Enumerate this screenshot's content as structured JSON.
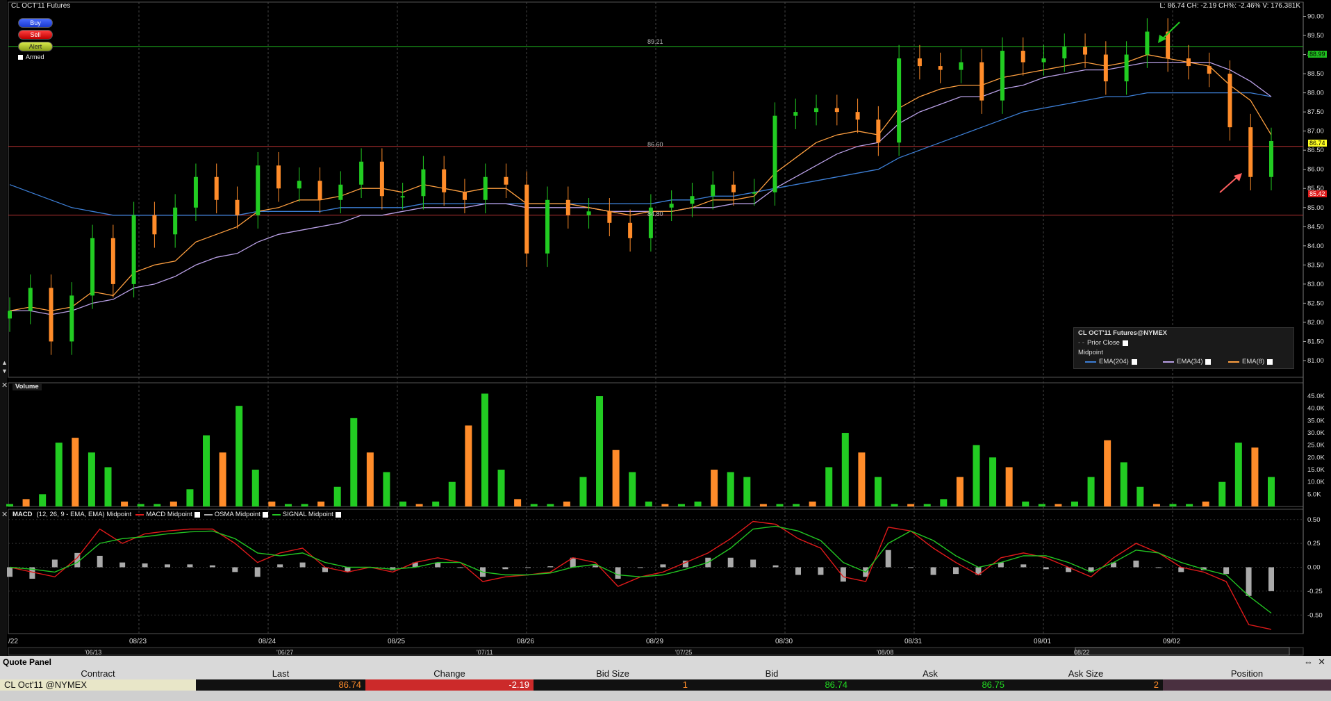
{
  "chart": {
    "title": "CL OCT'11 Futures",
    "status_line": "L: 86.74 CH: -2.19 CH%: -2.46% V: 176.381K",
    "buttons": {
      "buy": "Buy",
      "sell": "Sell",
      "alert": "Alert",
      "armed": "Armed"
    },
    "hlines": {
      "upper": "89.21",
      "middle": "86.60",
      "lower": "84.80"
    },
    "price_badges": {
      "green": "88.99",
      "yellow": "86.74",
      "red": "85.42"
    },
    "legend": {
      "title": "CL OCT'11 Futures@NYMEX",
      "prior_close": "Prior Close",
      "midpoint": "Midpoint",
      "ema204": "EMA(204)",
      "ema34": "EMA(34)",
      "ema8": "EMA(8)"
    },
    "volume_label": "Volume",
    "macd_label": "MACD",
    "macd_params": "(12, 26, 9 - EMA, EMA) Midpoint",
    "macd_legend": {
      "macd": "MACD Midpoint",
      "osma": "OSMA Midpoint",
      "signal": "SIGNAL Midpoint"
    },
    "colors": {
      "up": "#22cc22",
      "down": "#ff8c2a",
      "ema204": "#3d7fd6",
      "ema34": "#b9a0e6",
      "ema8": "#ffa040",
      "macd": "#e01a1a",
      "signal": "#22c422",
      "osma": "#aaaaaa",
      "hline_green": "#1fbf1f",
      "hline_red": "#b23030"
    }
  },
  "chart_data": [
    {
      "type": "bar",
      "title": "CL OCT'11 Futures",
      "y_ticks": [
        "90.00",
        "89.50",
        "89.00",
        "88.50",
        "88.00",
        "87.50",
        "87.00",
        "86.50",
        "86.00",
        "85.50",
        "85.00",
        "84.50",
        "84.00",
        "83.50",
        "83.00",
        "82.50",
        "82.00",
        "81.50",
        "81.00"
      ],
      "ylim": [
        80.8,
        90.1
      ],
      "x_ticks": [
        "08/23",
        "08/24",
        "08/25",
        "08/26",
        "08/29",
        "08/30",
        "08/31",
        "09/01",
        "09/02"
      ],
      "x_left_label": "/22",
      "overview_ticks": [
        "'06/13",
        "'06/27",
        "'07/11",
        "'07/25",
        "'08/08",
        "08/22"
      ],
      "close": [
        82.3,
        82.9,
        81.5,
        82.7,
        84.2,
        83.0,
        84.8,
        84.3,
        85.0,
        85.8,
        85.2,
        84.8,
        86.1,
        85.5,
        85.7,
        85.2,
        85.6,
        86.2,
        85.3,
        85.3,
        86.0,
        85.4,
        85.2,
        85.8,
        85.6,
        83.8,
        85.2,
        84.8,
        84.9,
        84.6,
        84.2,
        85.0,
        85.1,
        85.3,
        85.6,
        85.4,
        85.4,
        87.4,
        87.5,
        87.6,
        87.5,
        87.3,
        86.7,
        88.9,
        88.7,
        88.6,
        88.8,
        87.8,
        89.1,
        88.8,
        88.9,
        89.2,
        89.0,
        88.3,
        89.0,
        89.6,
        88.9,
        88.7,
        88.5,
        87.1,
        85.8,
        86.74
      ],
      "ema8": [
        82.3,
        82.4,
        82.3,
        82.4,
        82.8,
        82.7,
        83.3,
        83.5,
        83.6,
        84.1,
        84.3,
        84.5,
        84.9,
        85.0,
        85.2,
        85.2,
        85.3,
        85.5,
        85.5,
        85.4,
        85.6,
        85.5,
        85.4,
        85.5,
        85.5,
        85.1,
        85.1,
        85.1,
        85.0,
        84.9,
        84.8,
        84.9,
        84.9,
        85.0,
        85.2,
        85.2,
        85.3,
        85.9,
        86.3,
        86.7,
        86.9,
        87.0,
        86.9,
        87.6,
        87.9,
        88.1,
        88.2,
        88.2,
        88.4,
        88.5,
        88.6,
        88.7,
        88.8,
        88.7,
        88.8,
        89.0,
        88.9,
        88.8,
        88.7,
        88.2,
        87.8,
        86.9
      ],
      "ema34": [
        82.3,
        82.3,
        82.2,
        82.3,
        82.5,
        82.6,
        82.9,
        83.0,
        83.2,
        83.5,
        83.7,
        83.8,
        84.1,
        84.3,
        84.4,
        84.5,
        84.6,
        84.8,
        84.8,
        84.9,
        85.0,
        85.0,
        85.0,
        85.1,
        85.1,
        85.0,
        85.0,
        85.0,
        85.0,
        84.9,
        84.9,
        84.9,
        84.9,
        85.0,
        85.0,
        85.1,
        85.1,
        85.5,
        85.8,
        86.1,
        86.4,
        86.6,
        86.7,
        87.2,
        87.5,
        87.7,
        87.9,
        87.9,
        88.1,
        88.2,
        88.4,
        88.5,
        88.6,
        88.6,
        88.7,
        88.8,
        88.8,
        88.8,
        88.8,
        88.6,
        88.3,
        87.9
      ],
      "ema204": [
        85.6,
        85.4,
        85.2,
        85.0,
        84.9,
        84.8,
        84.8,
        84.8,
        84.8,
        84.8,
        84.8,
        84.8,
        84.9,
        84.9,
        84.9,
        84.9,
        85.0,
        85.0,
        85.0,
        85.0,
        85.1,
        85.1,
        85.1,
        85.1,
        85.1,
        85.1,
        85.1,
        85.1,
        85.1,
        85.1,
        85.1,
        85.1,
        85.2,
        85.2,
        85.3,
        85.3,
        85.4,
        85.5,
        85.6,
        85.7,
        85.8,
        85.9,
        86.0,
        86.3,
        86.5,
        86.7,
        86.9,
        87.1,
        87.3,
        87.5,
        87.6,
        87.7,
        87.8,
        87.9,
        87.9,
        88.0,
        88.0,
        88.0,
        88.0,
        88.0,
        88.0,
        87.9
      ]
    },
    {
      "type": "bar",
      "title": "Volume",
      "y_ticks": [
        "45.0K",
        "40.0K",
        "35.0K",
        "30.0K",
        "25.0K",
        "20.0K",
        "15.0K",
        "10.0K",
        "5.0K"
      ],
      "ylim": [
        0,
        47000
      ],
      "values": [
        1000,
        3000,
        5000,
        26000,
        28000,
        22000,
        16000,
        2000,
        1000,
        1000,
        2000,
        7000,
        29000,
        22000,
        41000,
        15000,
        2000,
        1000,
        1000,
        2000,
        8000,
        36000,
        22000,
        14000,
        2000,
        1000,
        2000,
        10000,
        33000,
        46000,
        15000,
        3000,
        1000,
        1000,
        2000,
        12000,
        45000,
        23000,
        14000,
        2000,
        1000,
        1000,
        2000,
        15000,
        14000,
        12000,
        1000,
        1000,
        1000,
        2000,
        16000,
        30000,
        22000,
        12000,
        1000,
        1000,
        1000,
        3000,
        12000,
        25000,
        20000,
        16000,
        2000,
        1000,
        1000,
        2000,
        12000,
        27000,
        18000,
        8000,
        1000,
        1000,
        1000,
        2000,
        10000,
        26000,
        24000,
        12000
      ]
    },
    {
      "type": "line",
      "title": "MACD",
      "y_ticks": [
        "0.50",
        "0.25",
        "0.00",
        "-0.25",
        "-0.50"
      ],
      "ylim": [
        -0.68,
        0.52
      ],
      "series": [
        {
          "name": "MACD Midpoint",
          "values": [
            0.0,
            -0.05,
            -0.1,
            0.1,
            0.4,
            0.25,
            0.35,
            0.38,
            0.4,
            0.4,
            0.25,
            0.05,
            0.15,
            0.2,
            0.0,
            -0.05,
            0.0,
            -0.05,
            0.05,
            0.1,
            0.05,
            -0.15,
            -0.1,
            -0.08,
            -0.05,
            0.1,
            0.05,
            -0.2,
            -0.1,
            -0.05,
            0.05,
            0.15,
            0.3,
            0.48,
            0.45,
            0.3,
            0.2,
            -0.1,
            -0.15,
            0.42,
            0.38,
            0.2,
            0.05,
            -0.08,
            0.1,
            0.15,
            0.1,
            0.0,
            -0.1,
            0.1,
            0.25,
            0.15,
            0.0,
            -0.05,
            -0.15,
            -0.6,
            -0.65
          ]
        },
        {
          "name": "SIGNAL Midpoint",
          "values": [
            0.0,
            -0.02,
            -0.05,
            0.05,
            0.25,
            0.3,
            0.32,
            0.35,
            0.37,
            0.38,
            0.3,
            0.15,
            0.12,
            0.15,
            0.05,
            0.0,
            0.0,
            -0.02,
            0.0,
            0.05,
            0.05,
            -0.05,
            -0.08,
            -0.08,
            -0.06,
            0.0,
            0.03,
            -0.08,
            -0.1,
            -0.08,
            -0.02,
            0.05,
            0.2,
            0.4,
            0.43,
            0.38,
            0.28,
            0.05,
            -0.05,
            0.25,
            0.38,
            0.28,
            0.12,
            0.0,
            0.05,
            0.12,
            0.12,
            0.05,
            -0.05,
            0.05,
            0.18,
            0.15,
            0.05,
            -0.02,
            -0.08,
            -0.3,
            -0.48
          ]
        },
        {
          "name": "OSMA Midpoint",
          "values": [
            -0.1,
            -0.12,
            0.08,
            0.15,
            0.12,
            0.05,
            0.04,
            0.03,
            0.03,
            0.02,
            -0.05,
            -0.1,
            0.03,
            0.05,
            -0.05,
            -0.05,
            0.0,
            -0.03,
            0.05,
            0.05,
            0.0,
            -0.1,
            -0.02,
            0.0,
            0.01,
            0.1,
            0.02,
            -0.12,
            0.0,
            0.03,
            0.07,
            0.1,
            0.1,
            0.08,
            0.02,
            -0.08,
            -0.08,
            -0.15,
            -0.1,
            0.18,
            0.0,
            -0.08,
            -0.07,
            -0.08,
            0.05,
            0.03,
            -0.02,
            -0.05,
            -0.05,
            0.05,
            0.07,
            0.0,
            -0.05,
            -0.03,
            -0.07,
            -0.3,
            -0.25
          ]
        }
      ]
    }
  ],
  "quote_panel": {
    "title": "Quote Panel",
    "headers": [
      "Contract",
      "Last",
      "Change",
      "Bid Size",
      "Bid",
      "Ask",
      "Ask Size",
      "Position"
    ],
    "row": [
      "CL Oct'11 @NYMEX",
      "86.74",
      "-2.19",
      "1",
      "86.74",
      "86.75",
      "2",
      ""
    ]
  }
}
